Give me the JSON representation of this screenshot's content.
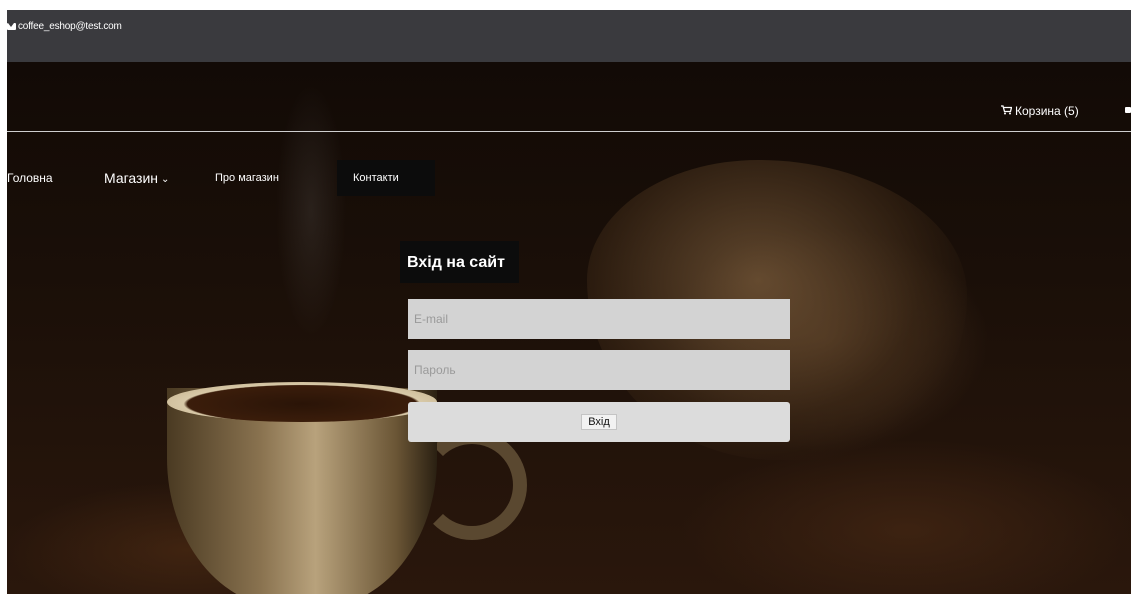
{
  "topbar": {
    "email": "coffee_eshop@test.com",
    "mail_icon": "envelope-icon"
  },
  "header": {
    "cart_label": "Корзина (5)",
    "cart_icon": "cart-icon",
    "lock_icon": "lock-icon"
  },
  "nav": {
    "items": [
      {
        "label": "Головна"
      },
      {
        "label": "Магазин",
        "has_dropdown": true,
        "chevron": "⌄"
      },
      {
        "label": "Про магазин"
      },
      {
        "label": "Контакти",
        "active": true
      }
    ]
  },
  "login": {
    "title": "Вхід на сайт",
    "email_placeholder": "E-mail",
    "password_placeholder": "Пароль",
    "submit_label": "Вхід"
  },
  "colors": {
    "topbar_bg": "#3a3a3e",
    "input_bg": "#d3d3d3",
    "button_bg": "#dcdcdc",
    "dark_box": "#0c0c0c"
  }
}
